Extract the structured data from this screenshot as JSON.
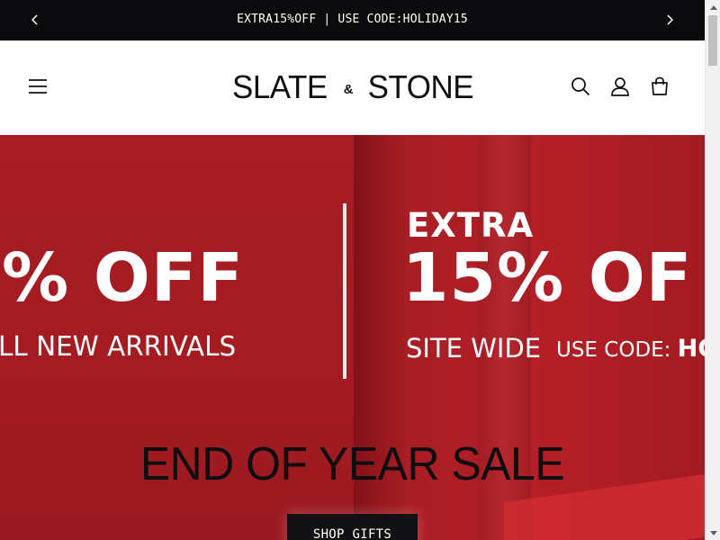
{
  "announcement": {
    "text": "EXTRA15%OFF | USE CODE:HOLIDAY15",
    "prev_icon": "chevron-left-icon",
    "next_icon": "chevron-right-icon"
  },
  "header": {
    "menu_icon": "hamburger-menu-icon",
    "logo": {
      "word1": "SLATE",
      "amp": "&",
      "word2": "STONE"
    },
    "search_icon": "search-icon",
    "account_icon": "user-icon",
    "cart_icon": "shopping-bag-icon"
  },
  "hero": {
    "left_big": "% OFF",
    "left_sub": "LL NEW ARRIVALS",
    "right_extra": "EXTRA",
    "right_big": "15% OF",
    "right_sitewide": "SITE WIDE",
    "right_usecode_label": "USE CODE:",
    "right_usecode_value": "HOL",
    "headline": "END OF YEAR SALE",
    "cta_label": "SHOP GIFTS"
  },
  "colors": {
    "announcement_bg": "#0b0b0d",
    "hero_red": "#a81c24",
    "button_bg": "#121214",
    "text_dark": "#0e0e10"
  }
}
